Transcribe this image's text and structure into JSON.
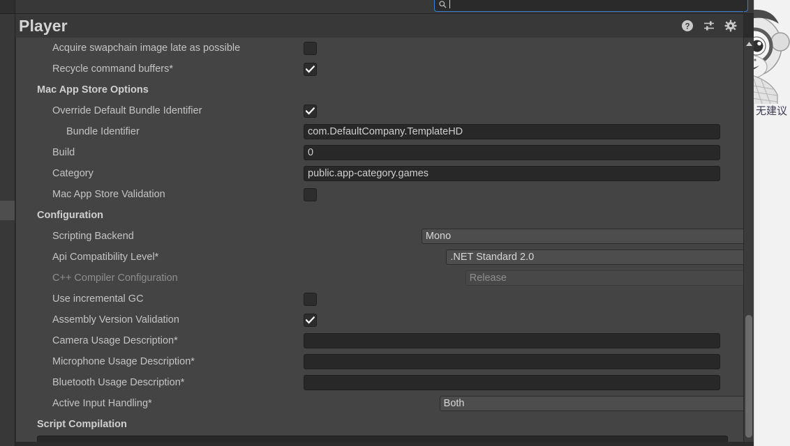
{
  "window": {
    "title": "Player"
  },
  "search": {
    "value": "",
    "placeholder": "",
    "icon": "search-icon"
  },
  "header_icons": [
    {
      "name": "help-icon",
      "label": "Help"
    },
    {
      "name": "preset-icon",
      "label": "Preset"
    },
    {
      "name": "gear-icon",
      "label": "Settings"
    }
  ],
  "rows": [
    {
      "label": "Acquire swapchain image late as possible",
      "indent": 1,
      "control": "checkbox",
      "checked": false,
      "clipped": true,
      "disabled": false
    },
    {
      "label": "Recycle command buffers*",
      "indent": 1,
      "control": "checkbox",
      "checked": true,
      "disabled": false
    },
    {
      "label": "Mac App Store Options",
      "control": "section"
    },
    {
      "label": "Override Default Bundle Identifier",
      "indent": 1,
      "control": "checkbox",
      "checked": true,
      "disabled": false
    },
    {
      "label": "Bundle Identifier",
      "indent": 2,
      "control": "textfield",
      "value": "com.DefaultCompany.TemplateHD",
      "disabled": false
    },
    {
      "label": "Build",
      "indent": 1,
      "control": "textfield",
      "value": "0",
      "disabled": false
    },
    {
      "label": "Category",
      "indent": 1,
      "control": "textfield",
      "value": "public.app-category.games",
      "disabled": false
    },
    {
      "label": "Mac App Store Validation",
      "indent": 1,
      "control": "checkbox",
      "checked": false,
      "disabled": false
    },
    {
      "label": "Configuration",
      "control": "section"
    },
    {
      "label": "Scripting Backend",
      "indent": 1,
      "control": "dropdown",
      "value": "Mono",
      "disabled": false
    },
    {
      "label": "Api Compatibility Level*",
      "indent": 1,
      "control": "dropdown",
      "value": ".NET Standard 2.0",
      "disabled": false
    },
    {
      "label": "C++ Compiler Configuration",
      "indent": 1,
      "control": "dropdown",
      "value": "Release",
      "disabled": true
    },
    {
      "label": "Use incremental GC",
      "indent": 1,
      "control": "checkbox",
      "checked": false,
      "disabled": false
    },
    {
      "label": "Assembly Version Validation",
      "indent": 1,
      "control": "checkbox",
      "checked": true,
      "disabled": false
    },
    {
      "label": "Camera Usage Description*",
      "indent": 1,
      "control": "textfield",
      "value": "",
      "disabled": false
    },
    {
      "label": "Microphone Usage Description*",
      "indent": 1,
      "control": "textfield",
      "value": "",
      "disabled": false
    },
    {
      "label": "Bluetooth Usage Description*",
      "indent": 1,
      "control": "textfield",
      "value": "",
      "disabled": false
    },
    {
      "label": "Active Input Handling*",
      "indent": 1,
      "control": "dropdown",
      "value": "Both",
      "disabled": false
    },
    {
      "label": "Script Compilation",
      "control": "section"
    }
  ],
  "side_panel": {
    "message": "无建议",
    "mascot": "monkey-monocle-mascot"
  },
  "colors": {
    "panel_bg": "#444444",
    "header_bg": "#383838",
    "field_bg": "#282828",
    "dropdown_bg": "#4d4d4d",
    "label_text": "#c4c4c4",
    "disabled_text": "#8e8e8e",
    "focus_border": "#3d7fd4",
    "scrollbar_thumb": "#6b6b6b"
  },
  "scrollbar": {
    "up_arrow": "caret-up-icon",
    "thumb_name": "vertical-scrollbar-thumb"
  }
}
